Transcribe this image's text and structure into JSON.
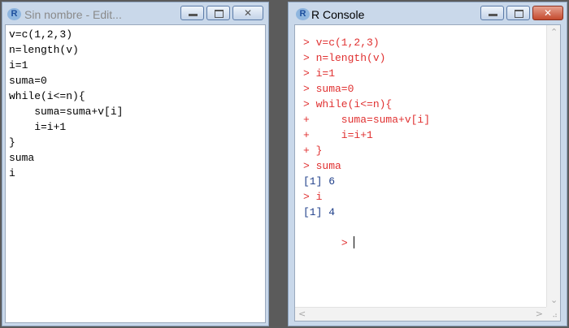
{
  "editor": {
    "app_icon": "R",
    "title": "Sin nombre - Edit...",
    "icons": {
      "minimize": "minimize-icon",
      "maximize": "maximize-icon",
      "close": "close-icon"
    },
    "lines": [
      "v=c(1,2,3)",
      "n=length(v)",
      "i=1",
      "suma=0",
      "while(i<=n){",
      "    suma=suma+v[i]",
      "    i=i+1",
      "}",
      "suma",
      "i"
    ]
  },
  "console": {
    "app_icon": "R",
    "title": "R Console",
    "icons": {
      "minimize": "minimize-icon",
      "maximize": "maximize-icon",
      "close": "close-icon"
    },
    "colors": {
      "input": "#e03030",
      "output": "#1f3f8a",
      "close_button": "#c44a2e"
    },
    "lines": [
      {
        "text": "> v=c(1,2,3)",
        "kind": "input"
      },
      {
        "text": "> n=length(v)",
        "kind": "input"
      },
      {
        "text": "> i=1",
        "kind": "input"
      },
      {
        "text": "> suma=0",
        "kind": "input"
      },
      {
        "text": "> while(i<=n){",
        "kind": "input"
      },
      {
        "text": "+     suma=suma+v[i]",
        "kind": "input"
      },
      {
        "text": "+     i=i+1",
        "kind": "input"
      },
      {
        "text": "+ }",
        "kind": "input"
      },
      {
        "text": "> suma",
        "kind": "input"
      },
      {
        "text": "[1] 6",
        "kind": "output"
      },
      {
        "text": "> i",
        "kind": "input"
      },
      {
        "text": "[1] 4",
        "kind": "output"
      }
    ],
    "prompt": "> "
  }
}
